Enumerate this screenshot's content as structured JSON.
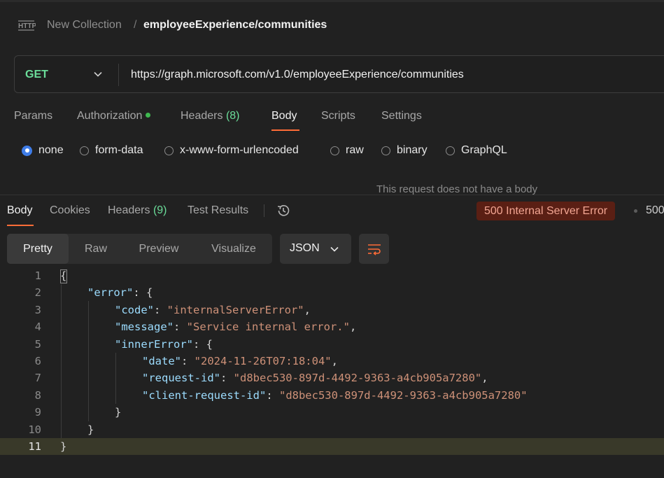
{
  "breadcrumb": {
    "collection": "New Collection",
    "separator": "/",
    "request": "employeeExperience/communities"
  },
  "request": {
    "method": "GET",
    "url": "https://graph.microsoft.com/v1.0/employeeExperience/communities",
    "tabs": [
      {
        "label": "Params"
      },
      {
        "label": "Authorization"
      },
      {
        "label": "Headers",
        "count": "(8)"
      },
      {
        "label": "Body",
        "active": true
      },
      {
        "label": "Scripts"
      },
      {
        "label": "Settings"
      }
    ],
    "body_types": [
      "none",
      "form-data",
      "x-www-form-urlencoded",
      "raw",
      "binary",
      "GraphQL"
    ],
    "selected_body_type": "none",
    "no_body_message": "This request does not have a body"
  },
  "response": {
    "tabs": [
      {
        "label": "Body",
        "active": true
      },
      {
        "label": "Cookies"
      },
      {
        "label": "Headers",
        "count": "(9)"
      },
      {
        "label": "Test Results"
      }
    ],
    "status": "500 Internal Server Error",
    "status_extra": "500",
    "view_modes": [
      "Pretty",
      "Raw",
      "Preview",
      "Visualize"
    ],
    "active_view": "Pretty",
    "format": "JSON",
    "code_lines": [
      "{",
      "\"error\": {",
      "\"code\": \"internalServerError\",",
      "\"message\": \"Service internal error.\",",
      "\"innerError\": {",
      "\"date\": \"2024-11-26T07:18:04\",",
      "\"request-id\": \"d8bec530-897d-4492-9363-a4cb905a7280\",",
      "\"client-request-id\": \"d8bec530-897d-4492-9363-a4cb905a7280\"",
      "}",
      "}",
      "}"
    ],
    "line_numbers": [
      "1",
      "2",
      "3",
      "4",
      "5",
      "6",
      "7",
      "8",
      "9",
      "10",
      "11"
    ]
  },
  "colors": {
    "method_get": "#6bdd9a",
    "accent_orange": "#ff6c37",
    "error_badge_bg": "#5a1f14",
    "error_badge_text": "#f2a592"
  },
  "icons": [
    "http-icon",
    "chevron-down-icon",
    "history-icon",
    "wrap-lines-icon"
  ]
}
